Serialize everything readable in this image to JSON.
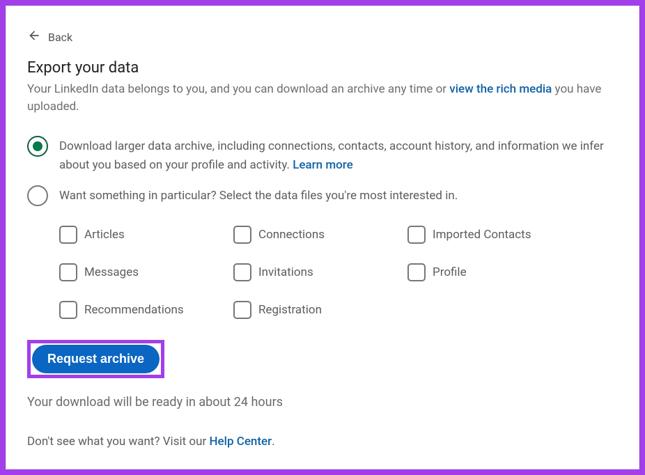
{
  "back": {
    "label": "Back"
  },
  "title": "Export your data",
  "subtitle": {
    "pre": "Your LinkedIn data belongs to you, and you can download an archive any time or ",
    "link": "view the rich media",
    "post": " you have uploaded."
  },
  "options": {
    "full": {
      "text_pre": "Download larger data archive, including connections, contacts, account history, and information we infer about you based on your profile and activity. ",
      "learn_more": "Learn more"
    },
    "particular": {
      "text": "Want something in particular? Select the data files you're most interested in."
    }
  },
  "checkboxes": [
    {
      "label": "Articles"
    },
    {
      "label": "Connections"
    },
    {
      "label": "Imported Contacts"
    },
    {
      "label": "Messages"
    },
    {
      "label": "Invitations"
    },
    {
      "label": "Profile"
    },
    {
      "label": "Recommendations"
    },
    {
      "label": "Registration"
    }
  ],
  "request_button": "Request archive",
  "status": "Your download will be ready in about 24 hours",
  "help": {
    "pre": "Don't see what you want? Visit our ",
    "link": "Help Center",
    "post": "."
  }
}
